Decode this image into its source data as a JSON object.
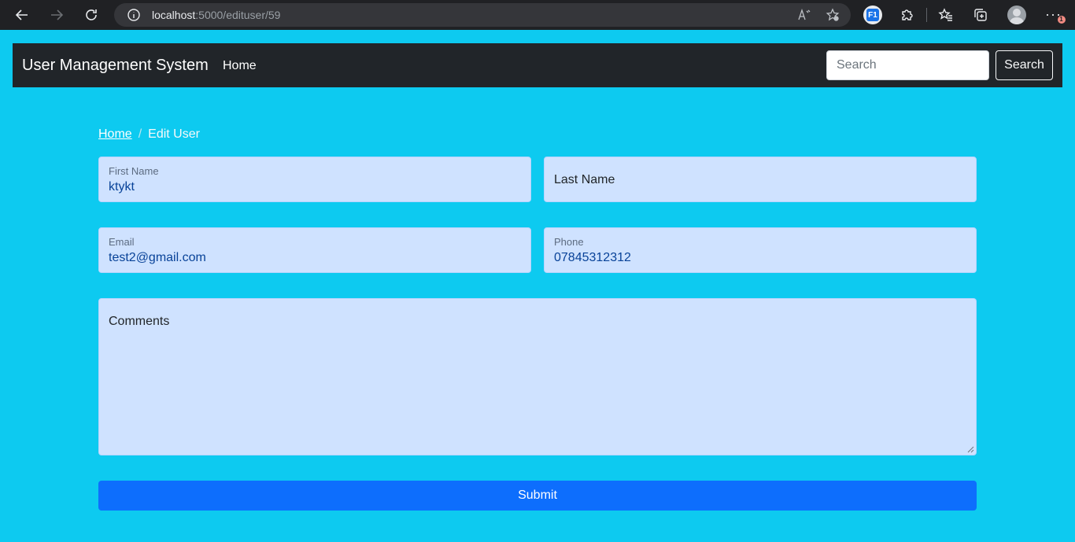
{
  "browser": {
    "url_host": "localhost",
    "url_path": ":5000/edituser/59",
    "extension_label": "F1",
    "notification_count": "1"
  },
  "navbar": {
    "brand": "User Management System",
    "home_link": "Home",
    "search_placeholder": "Search",
    "search_button": "Search"
  },
  "breadcrumb": {
    "home": "Home",
    "separator": "/",
    "current": "Edit User"
  },
  "form": {
    "first_name": {
      "label": "First Name",
      "value": "ktykt"
    },
    "last_name": {
      "label": "Last Name",
      "value": ""
    },
    "email": {
      "label": "Email",
      "value": "test2@gmail.com"
    },
    "phone": {
      "label": "Phone",
      "value": "07845312312"
    },
    "comments": {
      "label": "Comments",
      "value": ""
    },
    "submit_label": "Submit"
  },
  "colors": {
    "page_background": "#0dcaf0",
    "navbar_background": "#212529",
    "field_background": "#cfe2ff",
    "submit_background": "#0d6efd"
  }
}
